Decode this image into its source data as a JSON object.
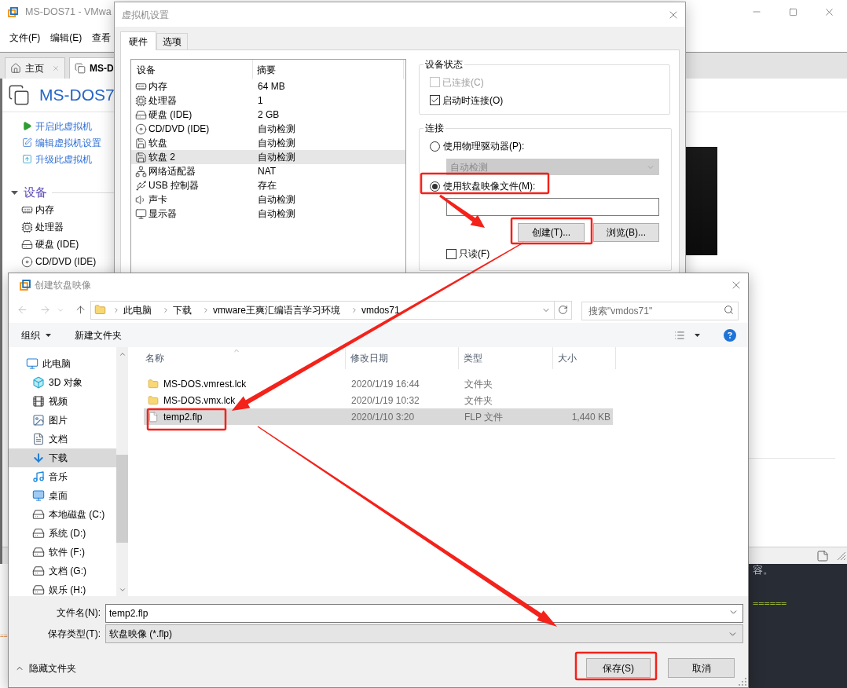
{
  "main_window": {
    "title": "MS-DOS71 - VMwa",
    "menu": [
      "文件(F)",
      "编辑(E)",
      "查看"
    ],
    "tabs": [
      {
        "label": "主页",
        "kind": "home",
        "selected": false,
        "closable": true
      },
      {
        "label": "MS-D",
        "kind": "vm",
        "selected": true,
        "closable": false
      }
    ],
    "vm_name": "MS-DOS7",
    "actions": [
      {
        "label": "开启此虚拟机",
        "kind": "power_on"
      },
      {
        "label": "编辑虚拟机设置",
        "kind": "edit"
      },
      {
        "label": "升级此虚拟机",
        "kind": "upgrade"
      }
    ],
    "devices_section": {
      "title": "设备",
      "expanded": true,
      "items": [
        {
          "label": "内存",
          "kind": "memory"
        },
        {
          "label": "处理器",
          "kind": "cpu"
        },
        {
          "label": "硬盘 (IDE)",
          "kind": "disk"
        },
        {
          "label": "CD/DVD (IDE)",
          "kind": "cd"
        }
      ]
    }
  },
  "background_editor": {
    "left_text": "==",
    "lines": [
      {
        "text": "容。",
        "kind": "prose"
      },
      {
        "text": "======",
        "kind": "markup"
      }
    ]
  },
  "settings_dialog": {
    "title": "虚拟机设置",
    "tabs": [
      {
        "label": "硬件",
        "selected": true
      },
      {
        "label": "选项",
        "selected": false
      }
    ],
    "device_table": {
      "columns": [
        "设备",
        "摘要"
      ],
      "rows": [
        {
          "kind": "memory",
          "device": "内存",
          "summary": "64 MB",
          "selected": false
        },
        {
          "kind": "cpu",
          "device": "处理器",
          "summary": "1",
          "selected": false
        },
        {
          "kind": "disk",
          "device": "硬盘 (IDE)",
          "summary": "2 GB",
          "selected": false
        },
        {
          "kind": "cd",
          "device": "CD/DVD (IDE)",
          "summary": "自动检测",
          "selected": false
        },
        {
          "kind": "floppy",
          "device": "软盘",
          "summary": "自动检测",
          "selected": false
        },
        {
          "kind": "floppy",
          "device": "软盘 2",
          "summary": "自动检测",
          "selected": true
        },
        {
          "kind": "network",
          "device": "网络适配器",
          "summary": "NAT",
          "selected": false
        },
        {
          "kind": "usb",
          "device": "USB 控制器",
          "summary": "存在",
          "selected": false
        },
        {
          "kind": "sound",
          "device": "声卡",
          "summary": "自动检测",
          "selected": false
        },
        {
          "kind": "display",
          "device": "显示器",
          "summary": "自动检测",
          "selected": false
        }
      ]
    },
    "device_status": {
      "title": "设备状态",
      "options": [
        {
          "label": "已连接(C)",
          "checked": false,
          "disabled": true
        },
        {
          "label": "启动时连接(O)",
          "checked": true,
          "disabled": false
        }
      ]
    },
    "connection": {
      "title": "连接",
      "sources": [
        {
          "kind": "physical",
          "label": "使用物理驱动器(P):",
          "selected": false
        },
        {
          "kind": "image",
          "label": "使用软盘映像文件(M):",
          "selected": true
        }
      ],
      "drive_select": {
        "value": "自动检测",
        "disabled": true
      },
      "buttons": [
        "创建(T)...",
        "浏览(B)..."
      ],
      "read_only": {
        "label": "只读(F)",
        "checked": false
      }
    }
  },
  "save_dialog": {
    "title": "创建软盘映像",
    "breadcrumb": [
      "此电脑",
      "下载",
      "vmware王爽汇编语言学习环境",
      "vmdos71"
    ],
    "search": {
      "placeholder": "搜索\"vmdos71\""
    },
    "commands": [
      {
        "label": "组织",
        "kind": "menu"
      },
      {
        "label": "新建文件夹",
        "kind": "button"
      }
    ],
    "nav_pane": [
      {
        "label": "此电脑",
        "kind": "pc",
        "selected": false,
        "children": [
          {
            "label": "3D 对象",
            "kind": "objects3d",
            "selected": false
          },
          {
            "label": "视频",
            "kind": "video",
            "selected": false
          },
          {
            "label": "图片",
            "kind": "pictures",
            "selected": false
          },
          {
            "label": "文档",
            "kind": "documents",
            "selected": false
          },
          {
            "label": "下载",
            "kind": "downloads",
            "selected": true
          },
          {
            "label": "音乐",
            "kind": "music",
            "selected": false
          },
          {
            "label": "桌面",
            "kind": "desktop",
            "selected": false
          },
          {
            "label": "本地磁盘 (C:)",
            "kind": "system_drive",
            "selected": false
          },
          {
            "label": "系统 (D:)",
            "kind": "drive",
            "selected": false
          },
          {
            "label": "软件 (F:)",
            "kind": "drive",
            "selected": false
          },
          {
            "label": "文档 (G:)",
            "kind": "drive",
            "selected": false
          },
          {
            "label": "娱乐 (H:)",
            "kind": "drive",
            "selected": false
          }
        ]
      }
    ],
    "file_table": {
      "columns": [
        {
          "label": "名称",
          "sorted": true
        },
        {
          "label": "修改日期",
          "sorted": false
        },
        {
          "label": "类型",
          "sorted": false
        },
        {
          "label": "大小",
          "sorted": false
        }
      ],
      "rows": [
        {
          "kind": "folder",
          "name": "MS-DOS.vmrest.lck",
          "modified": "2020/1/19 16:44",
          "type": "文件夹",
          "selected": false
        },
        {
          "kind": "folder",
          "name": "MS-DOS.vmx.lck",
          "modified": "2020/1/19 10:32",
          "type": "文件夹",
          "selected": false
        },
        {
          "kind": "file",
          "name": "temp2.flp",
          "modified": "2020/1/10 3:20",
          "type": "FLP 文件",
          "size": "1,440 KB",
          "selected": true
        }
      ]
    },
    "file_name": {
      "label": "文件名(N):",
      "value": "temp2.flp"
    },
    "file_type": {
      "label": "保存类型(T):",
      "value": "软盘映像 (*.flp)"
    },
    "hide_folders": "隐藏文件夹",
    "buttons": [
      "保存(S)",
      "取消"
    ]
  }
}
